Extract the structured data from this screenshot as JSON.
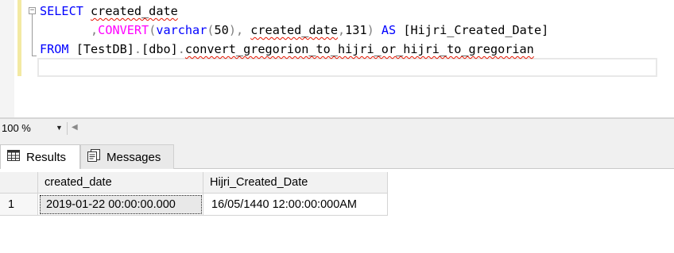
{
  "editor": {
    "line1": {
      "kw": "SELECT",
      "rest": "created_date"
    },
    "line2": {
      "comma": ",",
      "fn": "CONVERT",
      "p1": "(",
      "type": "varchar",
      "p2": "(",
      "num": "50",
      "p3": "),",
      "arg": "created_date",
      "p4": ",",
      "style": "131",
      "p5": ")",
      "as": "AS",
      "alias": "[Hijri_Created_Date]"
    },
    "line3": {
      "kw": "FROM",
      "db": "[TestDB]",
      "dot1": ".",
      "schema": "[dbo]",
      "dot2": ".",
      "table": "convert_gregorion_to_hijri_or_hijri_to_gregorian"
    }
  },
  "zoom": {
    "value": "100 %"
  },
  "tabs": [
    {
      "label": "Results",
      "icon": "grid-icon"
    },
    {
      "label": "Messages",
      "icon": "messages-icon"
    }
  ],
  "grid": {
    "columns": [
      "created_date",
      "Hijri_Created_Date"
    ],
    "rows": [
      {
        "num": "1",
        "created_date": "2019-01-22 00:00:00.000",
        "hijri": "16/05/1440 12:00:00:000AM"
      }
    ]
  },
  "colors": {
    "keyword": "#0000ff",
    "function": "#ff00ff",
    "squiggle": "#e51400",
    "change_bar": "#f3e9a2"
  }
}
